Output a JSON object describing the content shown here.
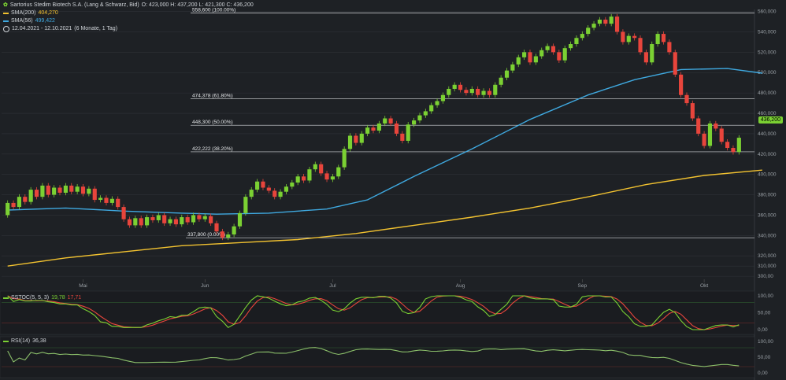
{
  "header": {
    "instrument": "Sartorius Stedim Biotech S.A. (Lang & Schwarz, Bid)",
    "ohlc": "O: 423,000  H: 437,200  L: 421,300  C: 436,200",
    "sma200_label": "SMA(200)",
    "sma200_value": "404,270",
    "sma56_label": "SMA(56)",
    "sma56_value": "499,422",
    "range": "12.04.2021 - 12.10.2021",
    "range_note": "(6 Monate, 1 Tag)",
    "icon": "leaf-icon"
  },
  "colors": {
    "background": "#1e2125",
    "up": "#7bd133",
    "down": "#e8453c",
    "sma200": "#f2c230",
    "sma56": "#3fa9e0",
    "grid": "#2e3238",
    "fib": "#d8dbde"
  },
  "price_badge": "436,200",
  "fib_levels": [
    {
      "label": "558,600 (100.00%)",
      "value": 558.6
    },
    {
      "label": "474,378 (61.80%)",
      "value": 474.378
    },
    {
      "label": "448,300 (50.00%)",
      "value": 448.3
    },
    {
      "label": "422,222 (38.20%)",
      "value": 422.222
    },
    {
      "label": "337,800 (0.00%)",
      "value": 337.8
    }
  ],
  "stoch": {
    "label": "SSTOC(5, 5, 3)",
    "k": "19,78",
    "d": "17,71",
    "ticks": [
      "100,00",
      "50,00",
      "0,00"
    ]
  },
  "rsi": {
    "label": "RSI(14)",
    "value": "36,38",
    "ticks": [
      "100,00",
      "50,00",
      "0,00"
    ]
  },
  "chart_data": {
    "type": "candlestick",
    "x_axis_labels": [
      "Mai",
      "Jun",
      "Jul",
      "Aug",
      "Sep",
      "Okt"
    ],
    "y_axis_ticks": [
      "300,00",
      "310,000",
      "320,000",
      "340,000",
      "360,000",
      "380,000",
      "400,000",
      "420,000",
      "440,000",
      "460,000",
      "480,000",
      "500,000",
      "520,000",
      "540,000",
      "560,000"
    ],
    "ylim": [
      297,
      562
    ],
    "x_months": {
      "Mai": 13,
      "Jun": 34,
      "Jul": 56,
      "Aug": 78,
      "Sep": 99,
      "Okt": 120
    },
    "candles": [
      [
        360,
        372
      ],
      [
        372,
        368
      ],
      [
        368,
        378
      ],
      [
        378,
        373
      ],
      [
        373,
        385
      ],
      [
        385,
        378
      ],
      [
        378,
        389
      ],
      [
        389,
        380
      ],
      [
        380,
        387
      ],
      [
        387,
        382
      ],
      [
        382,
        389
      ],
      [
        389,
        383
      ],
      [
        383,
        388
      ],
      [
        388,
        381
      ],
      [
        381,
        386
      ],
      [
        386,
        375
      ],
      [
        375,
        377
      ],
      [
        377,
        372
      ],
      [
        372,
        376
      ],
      [
        376,
        368
      ],
      [
        368,
        356
      ],
      [
        356,
        350
      ],
      [
        350,
        357
      ],
      [
        357,
        350
      ],
      [
        350,
        358
      ],
      [
        358,
        355
      ],
      [
        355,
        360
      ],
      [
        360,
        352
      ],
      [
        352,
        356
      ],
      [
        356,
        351
      ],
      [
        351,
        358
      ],
      [
        358,
        353
      ],
      [
        353,
        360
      ],
      [
        360,
        356
      ],
      [
        356,
        359
      ],
      [
        359,
        352
      ],
      [
        352,
        344
      ],
      [
        344,
        338
      ],
      [
        338,
        341
      ],
      [
        341,
        349
      ],
      [
        349,
        362
      ],
      [
        362,
        378
      ],
      [
        378,
        385
      ],
      [
        385,
        393
      ],
      [
        393,
        387
      ],
      [
        387,
        384
      ],
      [
        384,
        378
      ],
      [
        378,
        383
      ],
      [
        383,
        388
      ],
      [
        388,
        392
      ],
      [
        392,
        398
      ],
      [
        398,
        394
      ],
      [
        394,
        405
      ],
      [
        405,
        410
      ],
      [
        410,
        401
      ],
      [
        401,
        395
      ],
      [
        395,
        398
      ],
      [
        398,
        407
      ],
      [
        407,
        425
      ],
      [
        425,
        438
      ],
      [
        438,
        431
      ],
      [
        431,
        440
      ],
      [
        440,
        446
      ],
      [
        446,
        443
      ],
      [
        443,
        450
      ],
      [
        450,
        455
      ],
      [
        455,
        450
      ],
      [
        450,
        440
      ],
      [
        440,
        433
      ],
      [
        433,
        449
      ],
      [
        449,
        453
      ],
      [
        453,
        458
      ],
      [
        458,
        462
      ],
      [
        462,
        468
      ],
      [
        468,
        472
      ],
      [
        472,
        478
      ],
      [
        478,
        484
      ],
      [
        484,
        488
      ],
      [
        488,
        483
      ],
      [
        483,
        480
      ],
      [
        480,
        484
      ],
      [
        484,
        478
      ],
      [
        478,
        482
      ],
      [
        482,
        478
      ],
      [
        478,
        488
      ],
      [
        488,
        495
      ],
      [
        495,
        502
      ],
      [
        502,
        508
      ],
      [
        508,
        515
      ],
      [
        515,
        520
      ],
      [
        520,
        510
      ],
      [
        510,
        516
      ],
      [
        516,
        522
      ],
      [
        522,
        526
      ],
      [
        526,
        520
      ],
      [
        520,
        512
      ],
      [
        512,
        524
      ],
      [
        524,
        528
      ],
      [
        528,
        534
      ],
      [
        534,
        538
      ],
      [
        538,
        544
      ],
      [
        544,
        548
      ],
      [
        548,
        552
      ],
      [
        552,
        548
      ],
      [
        548,
        555
      ],
      [
        555,
        540
      ],
      [
        540,
        530
      ],
      [
        530,
        536
      ],
      [
        536,
        534
      ],
      [
        534,
        520
      ],
      [
        520,
        510
      ],
      [
        510,
        528
      ],
      [
        528,
        538
      ],
      [
        538,
        530
      ],
      [
        530,
        520
      ],
      [
        520,
        498
      ],
      [
        498,
        478
      ],
      [
        478,
        470
      ],
      [
        470,
        455
      ],
      [
        455,
        440
      ],
      [
        440,
        428
      ],
      [
        428,
        450
      ],
      [
        450,
        445
      ],
      [
        445,
        432
      ],
      [
        432,
        426
      ],
      [
        426,
        422
      ],
      [
        422,
        436
      ]
    ],
    "sma200": [
      [
        0,
        310
      ],
      [
        10,
        318
      ],
      [
        20,
        324
      ],
      [
        30,
        330
      ],
      [
        40,
        333
      ],
      [
        50,
        336
      ],
      [
        60,
        342
      ],
      [
        70,
        350
      ],
      [
        80,
        358
      ],
      [
        90,
        367
      ],
      [
        100,
        378
      ],
      [
        110,
        390
      ],
      [
        120,
        399
      ],
      [
        130,
        404.27
      ]
    ],
    "sma56": [
      [
        0,
        365
      ],
      [
        10,
        367
      ],
      [
        20,
        364
      ],
      [
        30,
        362
      ],
      [
        36,
        361
      ],
      [
        45,
        362
      ],
      [
        55,
        366
      ],
      [
        62,
        375
      ],
      [
        70,
        398
      ],
      [
        80,
        425
      ],
      [
        90,
        454
      ],
      [
        100,
        478
      ],
      [
        108,
        493
      ],
      [
        116,
        503
      ],
      [
        124,
        504
      ],
      [
        130,
        499.422
      ]
    ]
  }
}
